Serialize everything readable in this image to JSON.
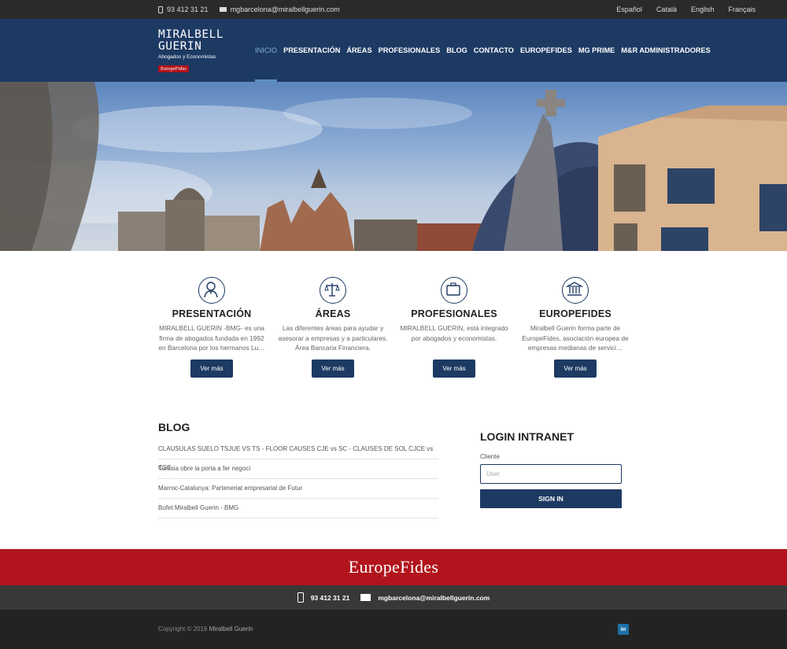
{
  "topbar": {
    "phone": "93 412 31 21",
    "email": "mgbarcelona@miralbellguerin.com",
    "languages": [
      "Español",
      "Català",
      "English",
      "Français"
    ]
  },
  "logo": {
    "line1": "MIRALBELL",
    "line2": "GUERIN",
    "tagline": "Abogados y Economistas",
    "badge": "EuropeFides"
  },
  "nav": {
    "items": [
      "INICIO",
      "PRESENTACIÓN",
      "ÁREAS",
      "PROFESIONALES",
      "BLOG",
      "CONTACTO",
      "EUROPEFIDES",
      "MG PRIME",
      "M&R ADMINISTRADORES"
    ],
    "active": "INICIO"
  },
  "features": [
    {
      "icon": "user-tie-icon",
      "title": "PRESENTACIÓN",
      "text": "MIRALBELL GUERIN -BMG- es una firma de abogados fundada en 1992 en Barcelona por los hermanos Lu…",
      "button": "Ver más"
    },
    {
      "icon": "scales-icon",
      "title": "ÁREAS",
      "text": "Las diferentes áreas para ayudar y asesorar a empresas y a particulares. Área Bancaria Financiera.",
      "button": "Ver más"
    },
    {
      "icon": "briefcase-icon",
      "title": "PROFESIONALES",
      "text": "MIRALBELL GUERIN, está integrado por abogados y economistas.",
      "button": "Ver más"
    },
    {
      "icon": "institution-icon",
      "title": "EUROPEFIDES",
      "text": "Miralbell Guerin forma parte de EuropeFides, asociación europea de empresas medianas de servici…",
      "button": "Ver más"
    }
  ],
  "blog": {
    "title": "BLOG",
    "posts": [
      "CLAUSULAS SUELO TSJUE VS TS - FLOOR CAUSES CJE vs SC - CLAUSES DE SOL CJCE vs CSE",
      "Tunísia obre la porta a fer negoci",
      "Marroc-Catalunya: Parteneriat empresarial de Futur",
      "Bufet Miralbell Guerin - BMG"
    ]
  },
  "login": {
    "title": "LOGIN INTRANET",
    "label": "Cliente",
    "placeholder": "User",
    "button": "SIGN IN"
  },
  "footer": {
    "brand": "EuropeFides",
    "phone": "93 412 31 21",
    "email": "mgbarcelona@miralbellguerin.com",
    "copyright": "Copyright © 2016",
    "company": "Miralbell Guerin",
    "social": "in"
  },
  "colors": {
    "navy": "#1d3a63",
    "red": "#b1141c",
    "topbar": "#2a2a2a"
  }
}
